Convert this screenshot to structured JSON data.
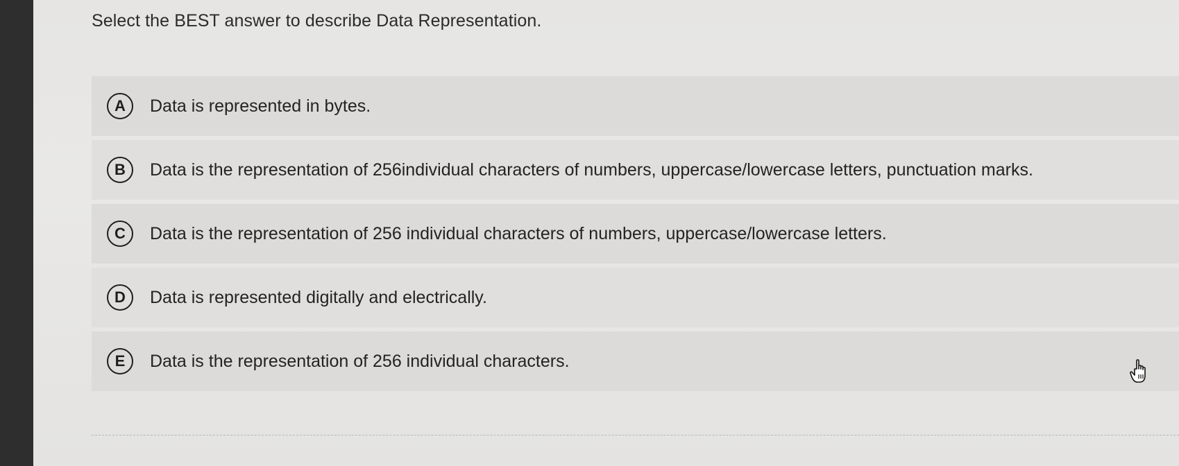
{
  "question": {
    "text": "Select the BEST answer to describe Data Representation."
  },
  "options": [
    {
      "letter": "A",
      "text": "Data is represented in bytes."
    },
    {
      "letter": "B",
      "text": "Data is the representation of 256individual characters of numbers, uppercase/lowercase letters, punctuation marks."
    },
    {
      "letter": "C",
      "text": "Data is the representation of 256 individual characters of numbers, uppercase/lowercase letters."
    },
    {
      "letter": "D",
      "text": "Data is represented digitally and electrically."
    },
    {
      "letter": "E",
      "text": "Data is the representation of 256 individual characters."
    }
  ],
  "cursor": {
    "icon": "hand-pointer-icon"
  }
}
